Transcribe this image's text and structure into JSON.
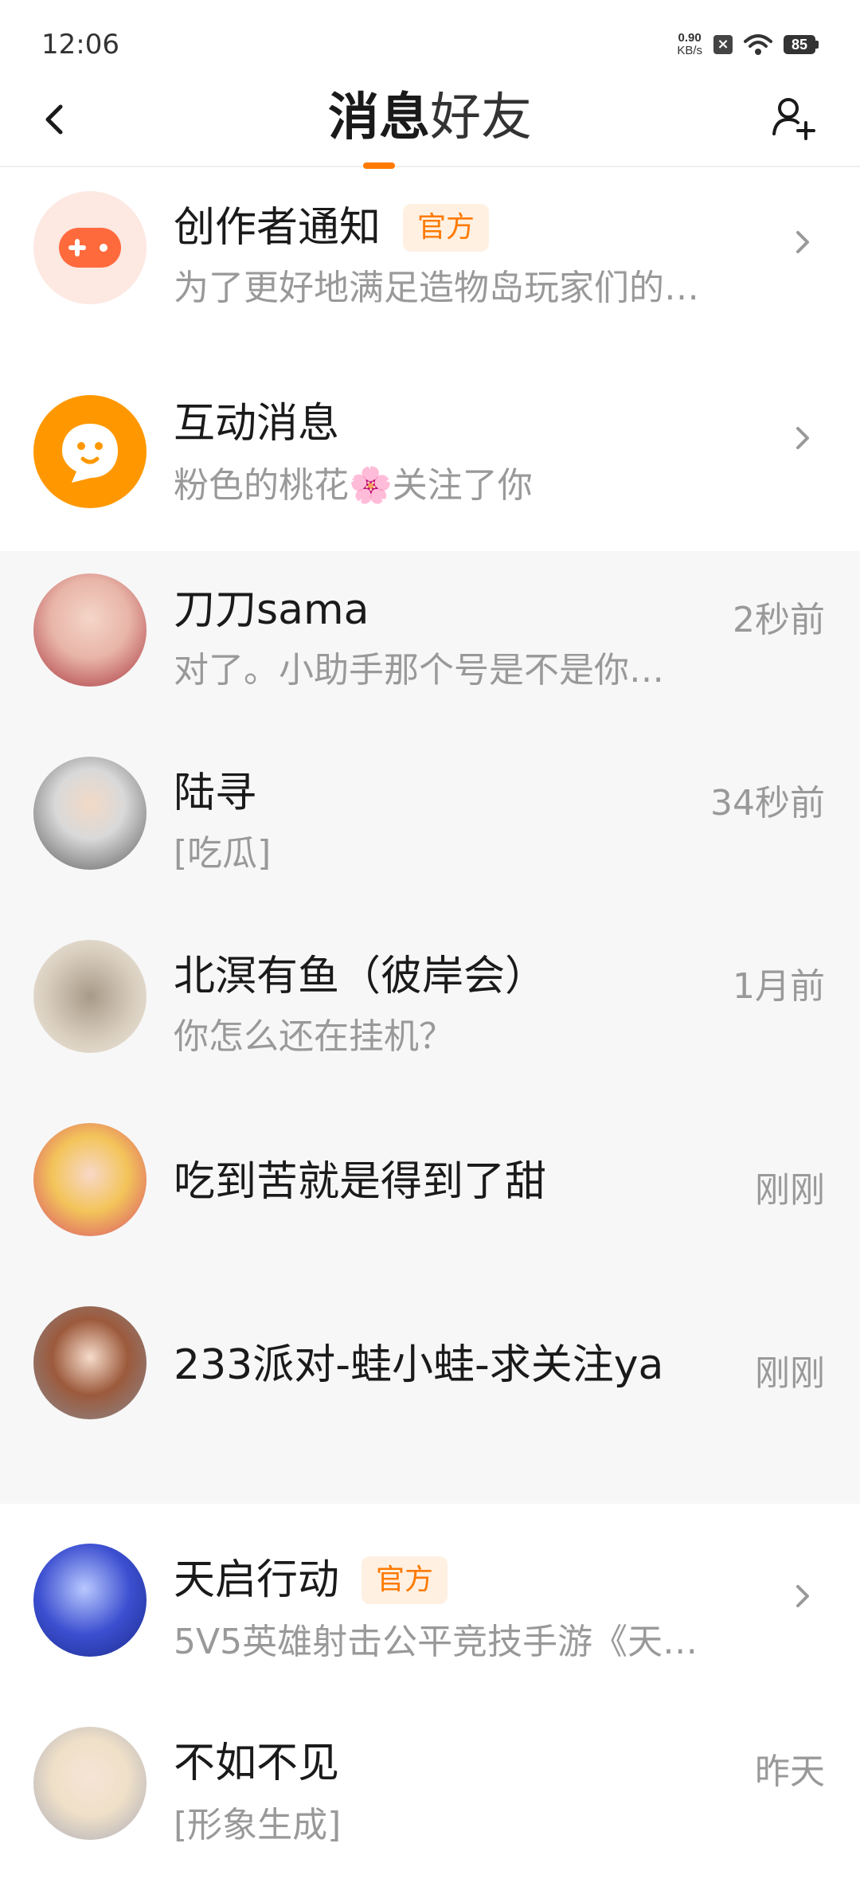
{
  "status_bar": {
    "time": "12:06",
    "net_speed_value": "0.90",
    "net_speed_unit": "KB/s",
    "battery": "85"
  },
  "header": {
    "tabs": [
      {
        "label": "消息",
        "active": true
      },
      {
        "label": "好友",
        "active": false
      }
    ],
    "icons": {
      "back": "back-icon",
      "add_friend": "add-friend-icon"
    }
  },
  "list": {
    "system": [
      {
        "name": "创作者通知",
        "badge": "官方",
        "preview": "为了更好地满足造物岛玩家们的…"
      },
      {
        "name": "互动消息",
        "preview": "粉色的桃花🌸关注了你"
      }
    ],
    "chats": [
      {
        "name": "刀刀sama",
        "time": "2秒前",
        "preview": "对了。小助手那个号是不是你…"
      },
      {
        "name": "陆寻",
        "time": "34秒前",
        "preview": "[吃瓜]"
      },
      {
        "name": "北溟有鱼（彼岸会）",
        "time": "1月前",
        "preview": "你怎么还在挂机？"
      },
      {
        "name": "吃到苦就是得到了甜",
        "time": "刚刚",
        "preview": ""
      },
      {
        "name": "233派对-蛙小蛙-求关注ya",
        "time": "刚刚",
        "preview": ""
      }
    ],
    "others": [
      {
        "name": "天启行动",
        "badge": "官方",
        "preview": "5V5英雄射击公平竞技手游《天…"
      },
      {
        "name": "不如不见",
        "time": "昨天",
        "preview": "[形象生成]"
      }
    ]
  },
  "colors": {
    "accent": "#ff7a00",
    "badge_bg": "#fff0e2",
    "pinned_bg": "#f7f7f7"
  }
}
